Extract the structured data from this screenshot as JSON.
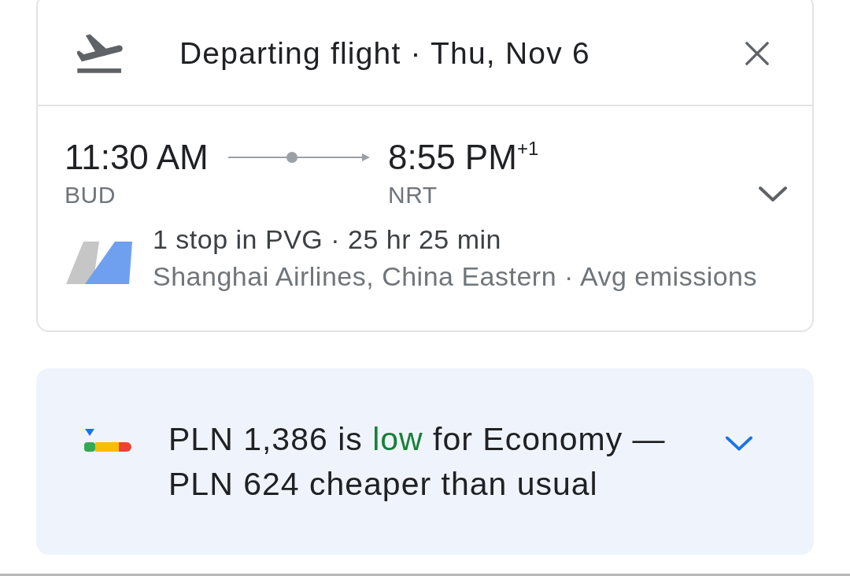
{
  "header": {
    "title": "Departing flight · Thu, Nov 6"
  },
  "itinerary": {
    "departure": {
      "time": "11:30 AM",
      "airport": "BUD"
    },
    "arrival": {
      "time": "8:55 PM$^{+1}$",
      "airport": "NRT"
    },
    "stops": "1 stop in PVG · 25 hr 25 min",
    "airlines": "Shanghai Airlines, China Eastern · Avg emissions",
    "expanded": false
  },
  "price_insight": {
    "parts": [
      {
        "kind": "plain",
        "text": "PLN 1,386 is "
      },
      {
        "kind": "highlight",
        "text": "low"
      },
      {
        "kind": "plain",
        "text": " for Economy — PLN 624 cheaper than usual"
      }
    ],
    "expanded": false
  }
}
